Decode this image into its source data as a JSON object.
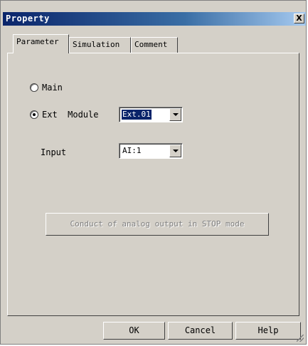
{
  "window": {
    "title": "Property",
    "close_glyph": "X"
  },
  "tabs": [
    {
      "label": "Parameter",
      "active": true
    },
    {
      "label": "Simulation",
      "active": false
    },
    {
      "label": "Comment",
      "active": false
    }
  ],
  "options": {
    "main_label": "Main",
    "main_checked": false,
    "ext_label": "Ext  Module",
    "ext_checked": true
  },
  "module_select": {
    "value": "Ext.01"
  },
  "input": {
    "label": "Input",
    "value": "AI:1"
  },
  "conduct_button": {
    "label": "Conduct of analog output in STOP  mode",
    "enabled": false
  },
  "footer": {
    "ok_label": "OK",
    "cancel_label": "Cancel",
    "help_label": "Help"
  },
  "colors": {
    "title_start": "#0a246a",
    "title_end": "#a6caf0",
    "face": "#d4d0c8"
  }
}
